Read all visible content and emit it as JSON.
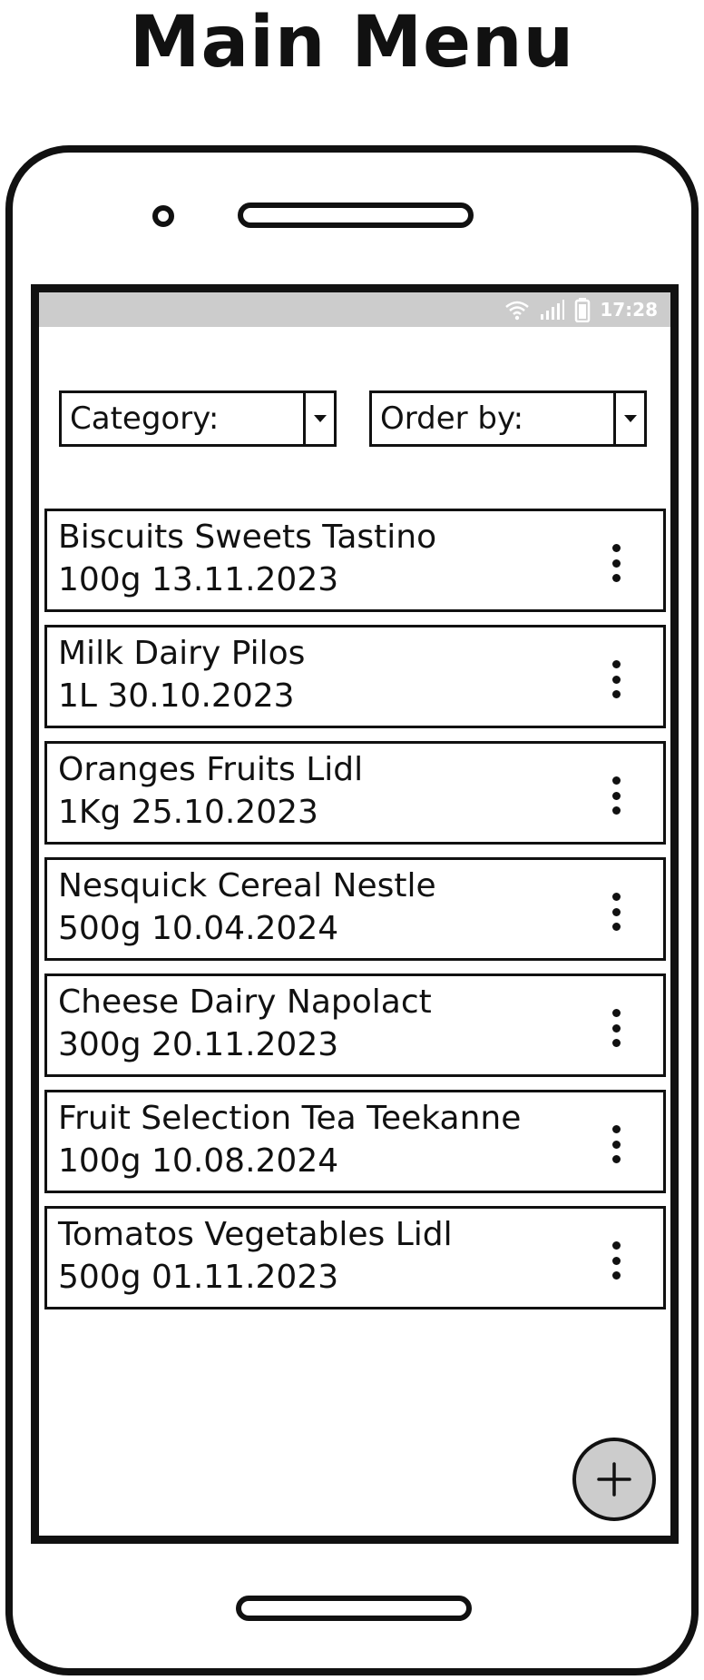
{
  "page": {
    "title": "Main Menu"
  },
  "status_bar": {
    "time": "17:28",
    "icons": [
      "wifi-icon",
      "signal-icon",
      "battery-icon"
    ]
  },
  "filters": {
    "category_label": "Category:",
    "order_label": "Order by:"
  },
  "items": [
    {
      "line1": "Biscuits Sweets Tastino",
      "line2": "100g 13.11.2023"
    },
    {
      "line1": "Milk Dairy Pilos",
      "line2": "1L  30.10.2023"
    },
    {
      "line1": "Oranges Fruits Lidl",
      "line2": "1Kg  25.10.2023"
    },
    {
      "line1": "Nesquick Cereal Nestle",
      "line2": "500g  10.04.2024"
    },
    {
      "line1": "Cheese Dairy Napolact",
      "line2": "300g  20.11.2023"
    },
    {
      "line1": "Fruit Selection Tea Teekanne",
      "line2": "100g  10.08.2024"
    },
    {
      "line1": "Tomatos Vegetables Lidl",
      "line2": "500g  01.11.2023"
    }
  ],
  "colors": {
    "status_bar": "#cccccc",
    "fab": "#cccccc",
    "ink": "#111111"
  },
  "fab": {
    "icon": "plus-icon"
  }
}
